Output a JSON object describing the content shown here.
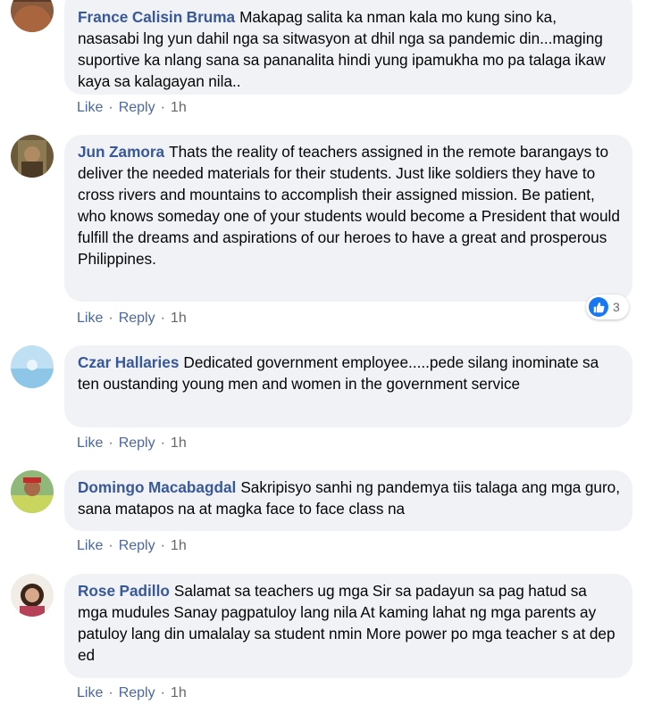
{
  "comments": [
    {
      "author": "France Calisin Bruma",
      "text": "Makapag salita ka nman kala mo kung sino ka, nasasabi lng yun dahil nga sa sitwasyon at dhil nga sa pandemic din...maging suportive ka nlang sana sa pananalita hindi yung ipamukha mo pa talaga ikaw kaya sa kalagayan nila..",
      "like": "Like",
      "reply": "Reply",
      "time": "1h"
    },
    {
      "author": "Jun Zamora",
      "text": "Thats the reality of teachers assigned in the remote barangays to deliver the needed materials for their students. Just like soldiers they have to cross rivers and mountains to accomplish their assigned mission. Be patient, who knows someday one of your students would become a President that would fulfill the dreams and aspirations of our heroes to have a great and prosperous Philippines.",
      "like": "Like",
      "reply": "Reply",
      "time": "1h",
      "reaction_count": "3"
    },
    {
      "author": "Czar Hallaries",
      "text": "Dedicated government employee.....pede silang inominate sa ten oustanding young men and women in the government service",
      "like": "Like",
      "reply": "Reply",
      "time": "1h"
    },
    {
      "author": "Domingo Macabagdal",
      "text": "Sakripisyo sanhi ng pandemya tiis talaga ang mga guro, sana matapos na at magka face to face class na",
      "like": "Like",
      "reply": "Reply",
      "time": "1h"
    },
    {
      "author": "Rose Padillo",
      "text": "Salamat sa teachers ug mga Sir sa padayun sa pag hatud sa mga mudules Sanay pagpatuloy lang nila At kaming lahat ng mga parents ay patuloy lang din umalalay sa student nmin More power po mga teacher s at dep ed",
      "like": "Like",
      "reply": "Reply",
      "time": "1h"
    }
  ],
  "separator": "·",
  "colors": {
    "bubble": "#f0f2f5",
    "author": "#385898",
    "action": "#4b68a1",
    "like_blue": "#1877f2"
  }
}
